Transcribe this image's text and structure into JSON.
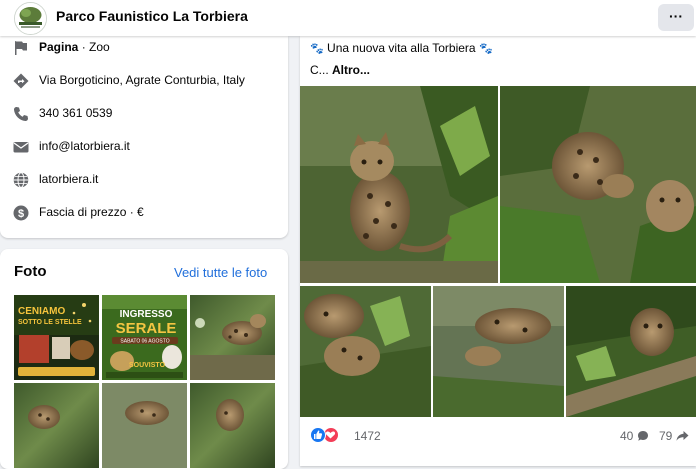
{
  "header": {
    "page_name": "Parco Faunistico La Torbiera",
    "more_label": "···"
  },
  "info": {
    "category_bold": "Pagina",
    "category_rest": " · Zoo",
    "address": "Via Borgoticino, Agrate Conturbia, Italy",
    "phone": "340 361 0539",
    "email": "info@latorbiera.it",
    "website": "latorbiera.it",
    "price": "Fascia di prezzo · €"
  },
  "photos": {
    "title": "Foto",
    "see_all": "Vedi tutte le foto",
    "thumb1": {
      "line1": "CENIAMO",
      "line2": "SOTTO LE STELLE"
    },
    "thumb2": {
      "line1": "INGRESSO",
      "line2": "SERALE",
      "line3": "SABATO 06 AGOSTO",
      "line4": "SOUVISTO"
    }
  },
  "post": {
    "text_line1": "Una nuova vita alla Torbiera",
    "text_ellipsis": "C... ",
    "text_more": "Altro...",
    "reactions_count": "1472",
    "comments_count": "40",
    "shares_count": "79",
    "paw_glyph": "🐾"
  },
  "colors": {
    "link": "#216fdb",
    "like": "#1877f2",
    "love": "#f33e58",
    "icon_gray": "#65676b"
  }
}
